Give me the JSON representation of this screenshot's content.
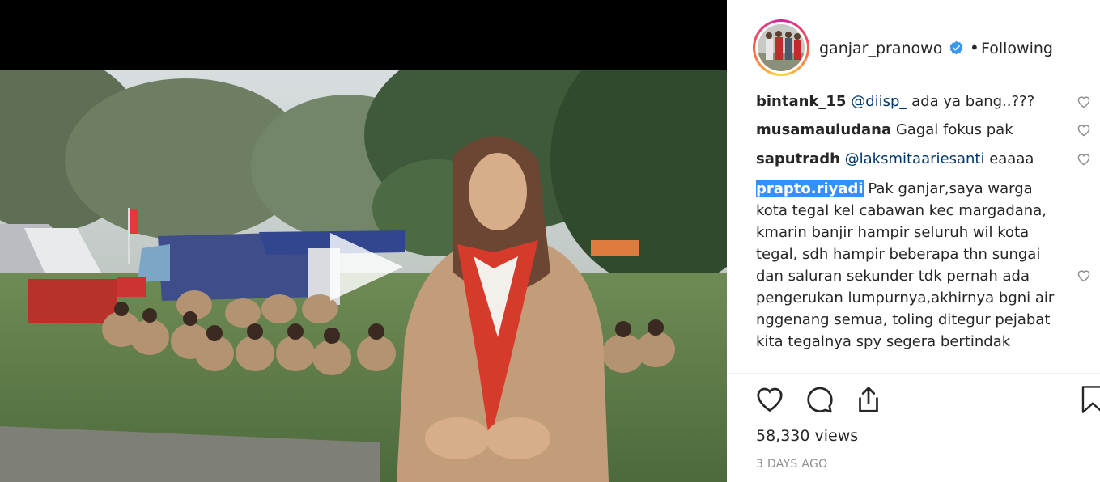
{
  "post": {
    "username": "ganjar_pranowo",
    "verified": true,
    "dot": "•",
    "follow_status": "Following",
    "views": "58,330 views",
    "date": "3 DAYS AGO"
  },
  "comments": [
    {
      "user": "bintank_15",
      "mention": "@diisp_",
      "text": " ada ya bang..???"
    },
    {
      "user": "musamauludana",
      "mention": "",
      "text": " Gagal fokus pak"
    },
    {
      "user": "saputradh",
      "mention": "@laksmitaariesanti",
      "text": " eaaaa"
    },
    {
      "user": "prapto.riyadi",
      "mention": "",
      "text": " Pak ganjar,saya warga kota tegal kel cabawan kec margadana, kmarin banjir hampir seluruh wil kota tegal, sdh hampir beberapa thn sungai dan saluran sekunder tdk pernah ada pengerukan lumpurnya,akhirnya bgni air nggenang semua, toling ditegur pejabat kita tegalnya spy segera bertindak"
    }
  ],
  "icons": {
    "verified": "verified-badge-icon",
    "heart": "heart-icon",
    "comment": "comment-icon",
    "share": "share-icon",
    "save": "bookmark-icon",
    "play": "play-icon"
  },
  "colors": {
    "text": "#262626",
    "muted": "#8e8e8e",
    "verified": "#3897f0",
    "selection": "#3390ff"
  }
}
